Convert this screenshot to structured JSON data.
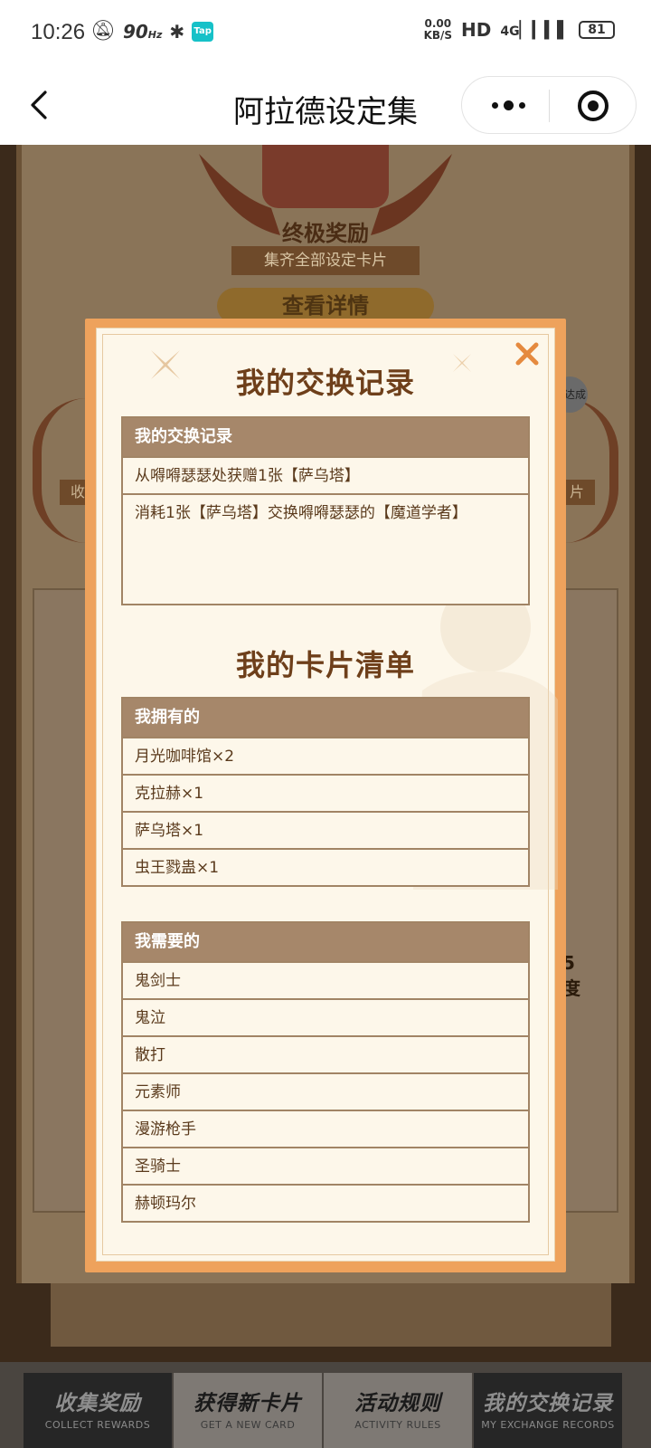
{
  "status_bar": {
    "time": "10:26",
    "network_label": "90",
    "network_unit": "Hz",
    "speed_value": "0.00",
    "speed_unit": "KB/S",
    "hd": "HD",
    "signal": "4G",
    "battery": "81",
    "app_badge": "Tap"
  },
  "title_bar": {
    "title": "阿拉德设定集"
  },
  "background": {
    "ultimate_reward": "终极奖励",
    "ultimate_sub": "集齐全部设定卡片",
    "view_details": "查看详情",
    "left_label": "收",
    "right_label": "片",
    "badge": "卡达成",
    "number": "5",
    "number_sub": "度"
  },
  "modal": {
    "exchange_section_title": "我的交换记录",
    "exchange_table": {
      "header": "我的交换记录",
      "rows": [
        "从嘚嘚瑟瑟处获赠1张【萨乌塔】",
        "消耗1张【萨乌塔】交换嘚嘚瑟瑟的【魔道学者】"
      ]
    },
    "cards_section_title": "我的卡片清单",
    "owned_table": {
      "header": "我拥有的",
      "rows": [
        "月光咖啡馆×2",
        "克拉赫×1",
        "萨乌塔×1",
        "虫王戮蛊×1"
      ]
    },
    "needed_table": {
      "header": "我需要的",
      "rows": [
        "鬼剑士",
        "鬼泣",
        "散打",
        "元素师",
        "漫游枪手",
        "圣骑士",
        "赫顿玛尔"
      ]
    }
  },
  "bottom_nav": [
    {
      "zh": "收集奖励",
      "en": "COLLECT REWARDS"
    },
    {
      "zh": "获得新卡片",
      "en": "GET A NEW CARD"
    },
    {
      "zh": "活动规则",
      "en": "ACTIVITY RULES"
    },
    {
      "zh": "我的交换记录",
      "en": "MY EXCHANGE RECORDS"
    }
  ],
  "colors": {
    "modal_border": "#eea25c",
    "table_header": "#a6876a",
    "section_title": "#6e3f1a",
    "row_text": "#5a3a1c"
  }
}
